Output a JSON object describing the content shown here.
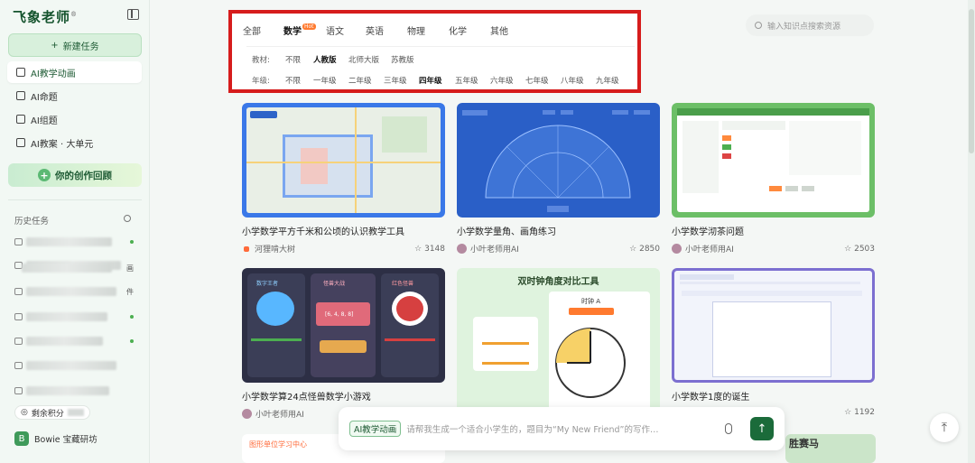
{
  "sidebar": {
    "logo": "飞象老师",
    "new_task": "新建任务",
    "nav": [
      {
        "label": "AI教学动画",
        "icon": "play-square-icon",
        "active": true
      },
      {
        "label": "AI命题",
        "icon": "document-icon"
      },
      {
        "label": "AI组题",
        "icon": "puzzle-icon"
      },
      {
        "label": "AI教案 · 大单元",
        "icon": "book-icon"
      }
    ],
    "creation": "你的创作回顾",
    "history_title": "历史任务",
    "history_suffixes": [
      "",
      "",
      "画",
      "件",
      "",
      "",
      "",
      ""
    ],
    "points_label": "剩余积分",
    "user_name": "Bowie 宝藏研坊",
    "user_initial": "B"
  },
  "filter": {
    "subjects": [
      {
        "label": "全部"
      },
      {
        "label": "数学",
        "badge": "Hot",
        "active": true
      },
      {
        "label": "语文"
      },
      {
        "label": "英语"
      },
      {
        "label": "物理"
      },
      {
        "label": "化学"
      },
      {
        "label": "其他"
      }
    ],
    "textbook_label": "教材:",
    "textbooks": [
      {
        "label": "不限"
      },
      {
        "label": "人教版",
        "active": true
      },
      {
        "label": "北师大版"
      },
      {
        "label": "苏教版"
      }
    ],
    "grade_label": "年级:",
    "grades": [
      {
        "label": "不限"
      },
      {
        "label": "一年级"
      },
      {
        "label": "二年级"
      },
      {
        "label": "三年级"
      },
      {
        "label": "四年级",
        "active": true
      },
      {
        "label": "五年级"
      },
      {
        "label": "六年级"
      },
      {
        "label": "七年级"
      },
      {
        "label": "八年级"
      },
      {
        "label": "九年级"
      }
    ]
  },
  "search": {
    "placeholder": "输入知识点搜索资源"
  },
  "cards": [
    {
      "title": "小学数学平方千米和公顷的认识教学工具",
      "author": "河狸啃大树",
      "stars": "3148"
    },
    {
      "title": "小学数学量角、画角练习",
      "author": "小叶老师用AI",
      "stars": "2850"
    },
    {
      "title": "小学数学沏茶问题",
      "author": "小叶老师用AI",
      "stars": "2503"
    },
    {
      "title": "小学数学算24点怪兽数学小游戏",
      "author": "小叶老师用AI",
      "stars": ""
    },
    {
      "title": "双时钟角度对比工具",
      "author": "",
      "stars": ""
    },
    {
      "title": "小学数学1度的诞生",
      "author": "",
      "stars": "1192"
    }
  ],
  "thumbs": {
    "clock_title": "双时钟角度对比工具",
    "clock_sub": "时钟 A",
    "game_left": "数字王者",
    "game_mid": "怪兽大战",
    "game_right": "红色怪兽",
    "game_nums": "[6, 4, 8, 8]",
    "bottom_left_title": "图形单位学习中心",
    "bottom_right_title": "胜赛马"
  },
  "chat": {
    "tag": "AI教学动画",
    "placeholder": "请帮我生成一个适合小学生的，题目为“My New Friend”的写作…"
  },
  "colors": {
    "accent": "#1b6b3a",
    "highlight_border": "#d61c1c",
    "hot_badge": "#ff7a2f"
  }
}
